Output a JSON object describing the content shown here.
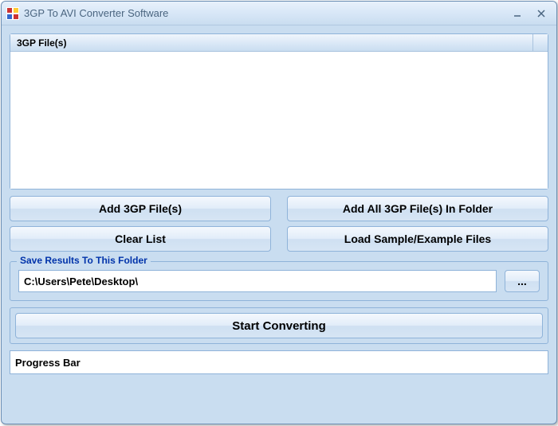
{
  "window": {
    "title": "3GP To AVI Converter Software"
  },
  "list": {
    "column_header": "3GP File(s)"
  },
  "buttons": {
    "add_files": "Add 3GP File(s)",
    "add_folder": "Add All 3GP File(s) In Folder",
    "clear_list": "Clear List",
    "load_sample": "Load Sample/Example Files",
    "browse": "...",
    "start": "Start Converting"
  },
  "save_section": {
    "legend": "Save Results To This Folder",
    "path": "C:\\Users\\Pete\\Desktop\\"
  },
  "progress": {
    "label": "Progress Bar"
  }
}
